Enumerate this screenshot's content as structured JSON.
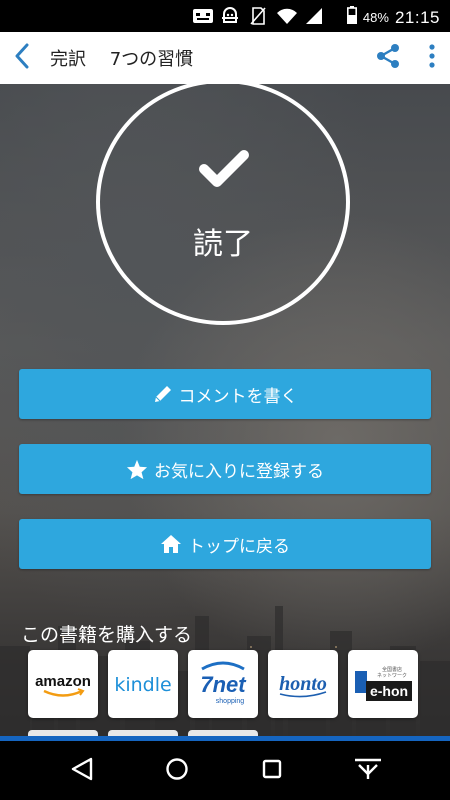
{
  "status_bar": {
    "battery": "48%",
    "time": "21:15"
  },
  "app_bar": {
    "title": "完訳　 7つの習慣"
  },
  "completion": {
    "label": "読了"
  },
  "buttons": {
    "comment": "コメントを書く",
    "favorite": "お気に入りに登録する",
    "top": "トップに戻る"
  },
  "purchase": {
    "heading": "この書籍を購入する",
    "stores": [
      {
        "name": "amazon"
      },
      {
        "name": "kindle"
      },
      {
        "name": "7net",
        "sub": "shopping"
      },
      {
        "name": "honto"
      },
      {
        "name": "e-hon",
        "sub_lines": [
          "全国書店",
          "ネットワーク"
        ]
      }
    ]
  },
  "colors": {
    "accent": "#2ea7de",
    "appbar_icon": "#2d7fc1",
    "strip": "#1565c0"
  }
}
